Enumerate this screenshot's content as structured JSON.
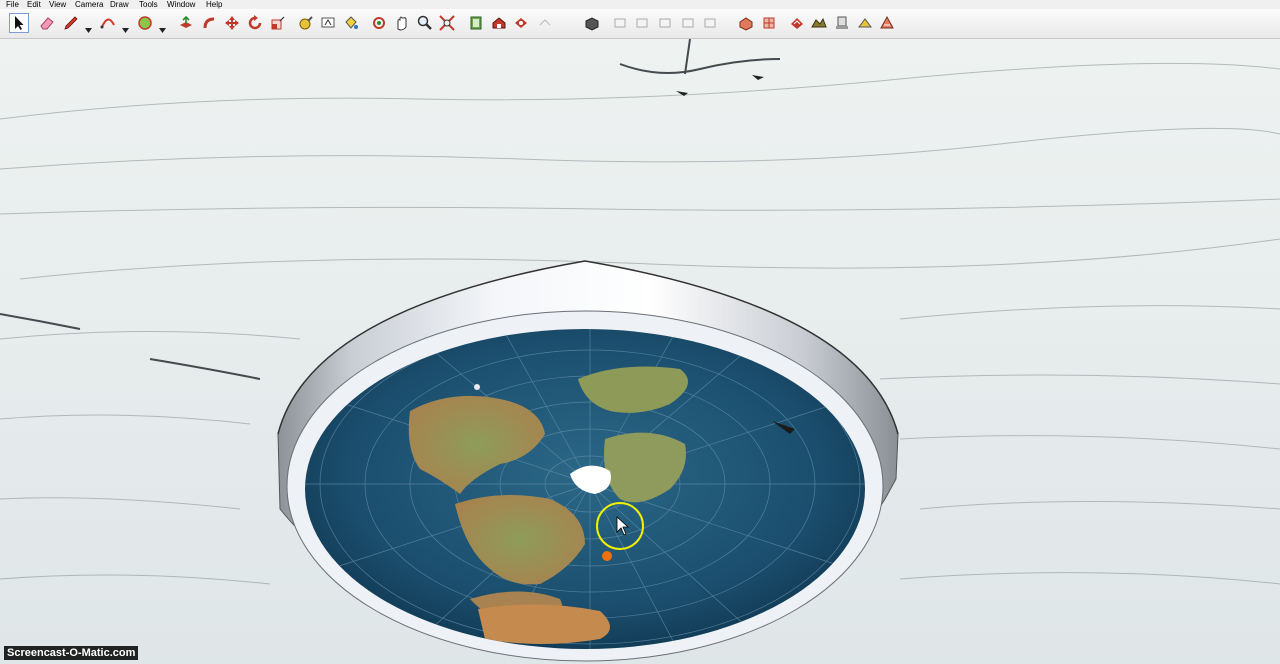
{
  "menu": [
    "File",
    "Edit",
    "View",
    "Camera",
    "Draw",
    "Tools",
    "Window",
    "Help"
  ],
  "watermark": "Screencast-O-Matic.com",
  "icons": {
    "select": "select-arrow-icon",
    "eraser": "eraser-icon",
    "pencil": "pencil-icon",
    "arc": "arc-icon",
    "shape": "shape-icon",
    "push_pull": "push-pull-icon",
    "follow_me": "follow-me-icon",
    "move": "move-icon",
    "rotate": "rotate-icon",
    "scale": "scale-icon",
    "tape": "tape-measure-icon",
    "text": "text-icon",
    "paint": "paint-bucket-icon",
    "orbit": "orbit-icon",
    "pan": "pan-icon",
    "zoom": "zoom-icon",
    "zoom_extents": "zoom-extents-icon",
    "components": "components-icon",
    "warehouse": "warehouse-icon",
    "share": "share-model-icon",
    "views": "standard-views-icon",
    "styles": "styles-icon",
    "sandbox": "sandbox-icon",
    "geo": "geo-location-icon"
  },
  "colors": {
    "ocean": "#16435e",
    "rim": "#dfe3ea",
    "ice": "#e7ecee",
    "cursor_ring": "#f2f000",
    "marker": "#f07010"
  }
}
